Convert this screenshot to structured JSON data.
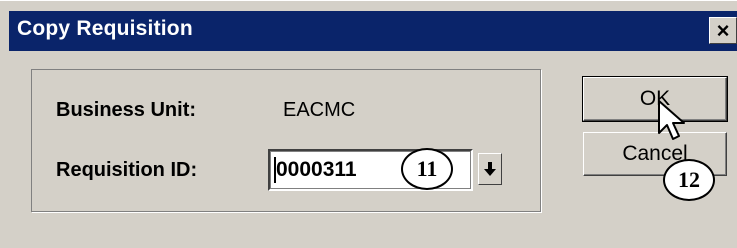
{
  "window": {
    "title": "Copy Requisition",
    "close_label": "×"
  },
  "form": {
    "business_unit_label": "Business Unit:",
    "business_unit_value": "EACMC",
    "requisition_id_label": "Requisition ID:",
    "requisition_id_value": "0000311"
  },
  "buttons": {
    "ok": "OK",
    "cancel": "Cancel"
  },
  "callouts": {
    "step_11": "11",
    "step_12": "12"
  },
  "icons": {
    "dropdown": "down-arrow-icon",
    "cursor": "mouse-pointer-icon"
  }
}
